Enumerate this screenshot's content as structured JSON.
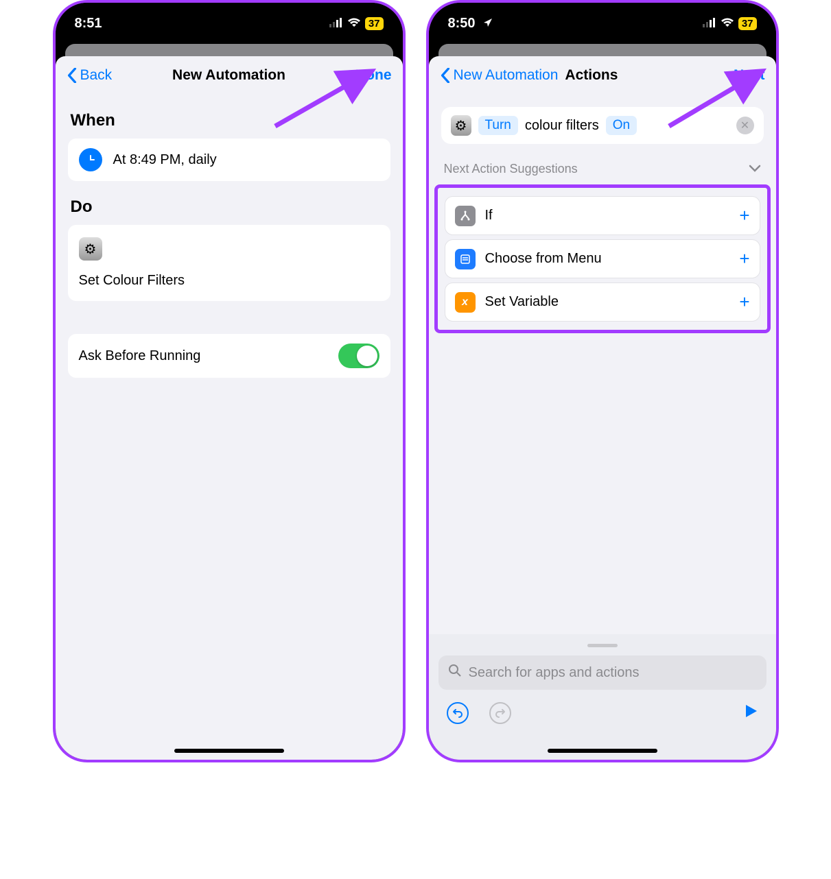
{
  "left": {
    "status": {
      "time": "8:51",
      "battery": "37"
    },
    "nav": {
      "back": "Back",
      "title": "New Automation",
      "done": "Done"
    },
    "when": {
      "header": "When",
      "text": "At 8:49 PM, daily"
    },
    "do": {
      "header": "Do",
      "action": "Set Colour Filters"
    },
    "ask": {
      "label": "Ask Before Running",
      "on": true
    }
  },
  "right": {
    "status": {
      "time": "8:50",
      "battery": "37"
    },
    "nav": {
      "back": "New Automation",
      "title": "Actions",
      "next": "Next"
    },
    "action": {
      "verb": "Turn",
      "param": "colour filters",
      "state": "On"
    },
    "suggestions": {
      "header": "Next Action Suggestions",
      "items": [
        {
          "label": "If",
          "icon": "branch",
          "color": "#8e8e93"
        },
        {
          "label": "Choose from Menu",
          "icon": "menu",
          "color": "#1e7cff"
        },
        {
          "label": "Set Variable",
          "icon": "var",
          "color": "#ff9500"
        }
      ]
    },
    "search": {
      "placeholder": "Search for apps and actions"
    }
  }
}
